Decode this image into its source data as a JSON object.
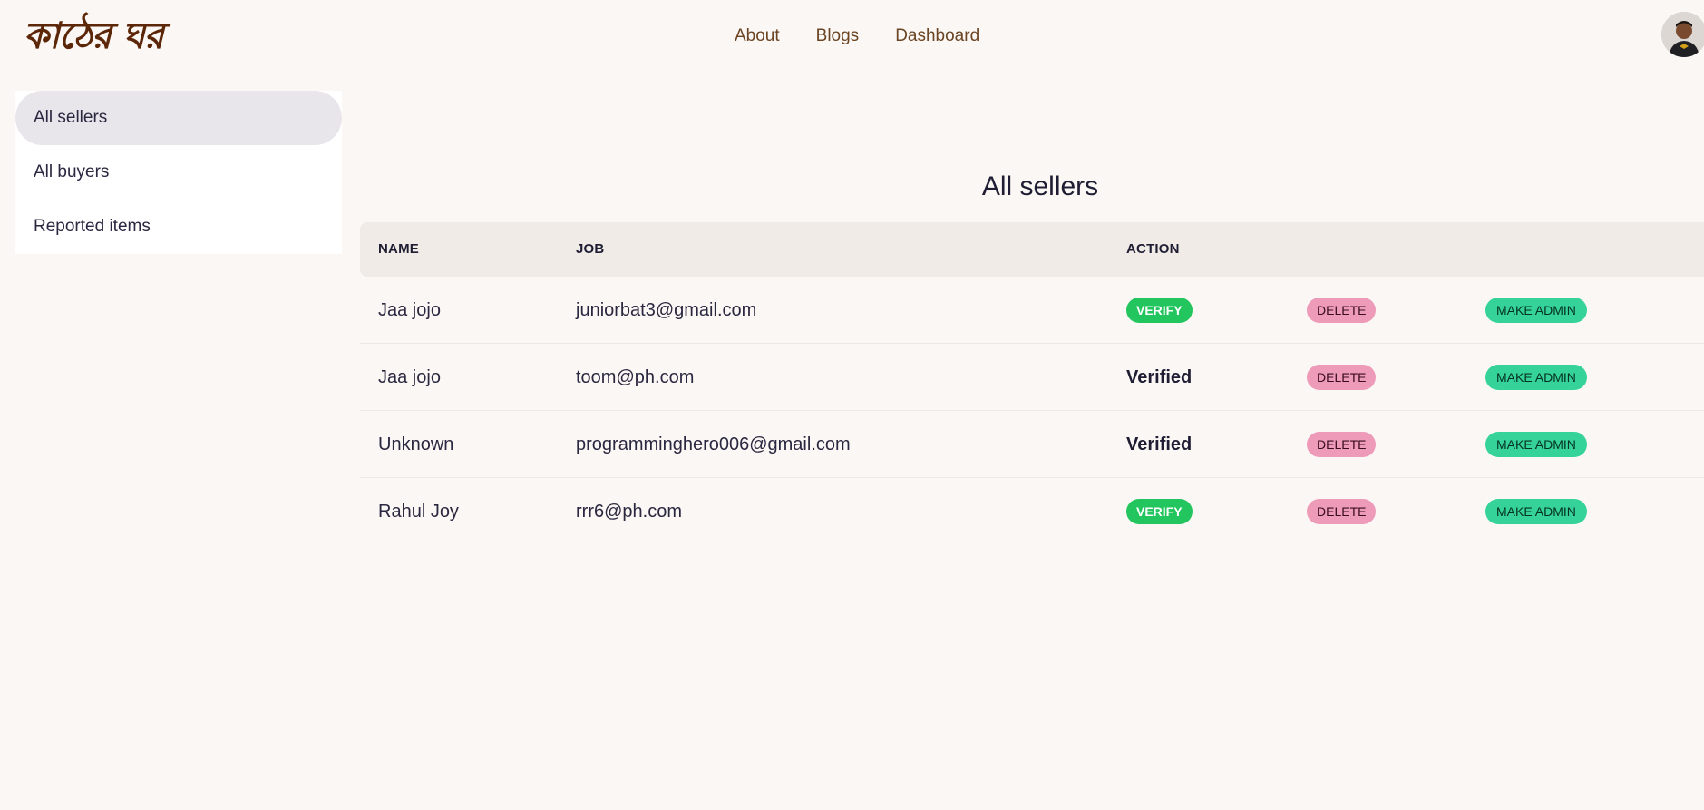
{
  "brand": {
    "logo_text": "কাঠের ঘর"
  },
  "nav": {
    "links": [
      "About",
      "Blogs",
      "Dashboard"
    ]
  },
  "sidebar": {
    "items": [
      {
        "label": "All sellers",
        "active": true
      },
      {
        "label": "All buyers",
        "active": false
      },
      {
        "label": "Reported items",
        "active": false
      }
    ]
  },
  "page": {
    "title": "All sellers"
  },
  "table": {
    "headers": {
      "name": "NAME",
      "job": "JOB",
      "action": "ACTION"
    },
    "rows": [
      {
        "name": "Jaa jojo",
        "email": "juniorbat3@gmail.com",
        "status": "verify",
        "verify_label": "VERIFY",
        "delete_label": "DELETE",
        "admin_label": "MAKE ADMIN"
      },
      {
        "name": "Jaa jojo",
        "email": "toom@ph.com",
        "status": "verified",
        "verified_label": "Verified",
        "delete_label": "DELETE",
        "admin_label": "MAKE ADMIN"
      },
      {
        "name": "Unknown",
        "email": "programminghero006@gmail.com",
        "status": "verified",
        "verified_label": "Verified",
        "delete_label": "DELETE",
        "admin_label": "MAKE ADMIN"
      },
      {
        "name": "Rahul Joy",
        "email": "rrr6@ph.com",
        "status": "verify",
        "verify_label": "VERIFY",
        "delete_label": "DELETE",
        "admin_label": "MAKE ADMIN"
      }
    ]
  },
  "colors": {
    "verify": "#22c55e",
    "delete": "#ee9ab9",
    "admin": "#35d399",
    "brand": "#5c2608"
  }
}
